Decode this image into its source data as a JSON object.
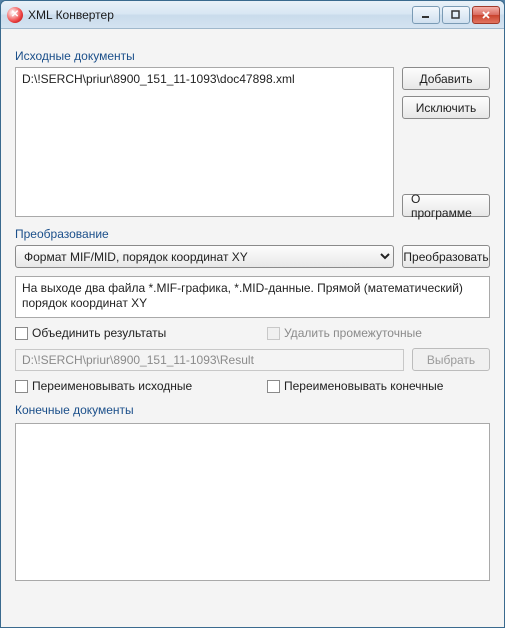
{
  "window": {
    "title": "XML Конвертер"
  },
  "sections": {
    "source_label": "Исходные документы",
    "transform_label": "Преобразование",
    "output_label": "Конечные документы"
  },
  "source": {
    "items": [
      "D:\\!SERCH\\priur\\8900_151_11-1093\\doc47898.xml"
    ]
  },
  "buttons": {
    "add": "Добавить",
    "exclude": "Исключить",
    "about": "О программе",
    "convert": "Преобразовать",
    "select": "Выбрать"
  },
  "transform": {
    "format_selected": "Формат MIF/MID, порядок координат XY",
    "description": "На выходе два файла *.MIF-графика, *.MID-данные. Прямой (математический) порядок координат XY",
    "merge_label": "Объединить результаты",
    "delete_temp_label": "Удалить промежуточные",
    "result_path": "D:\\!SERCH\\priur\\8900_151_11-1093\\Result",
    "rename_src_label": "Переименовывать исходные",
    "rename_dst_label": "Переименовывать конечные"
  }
}
